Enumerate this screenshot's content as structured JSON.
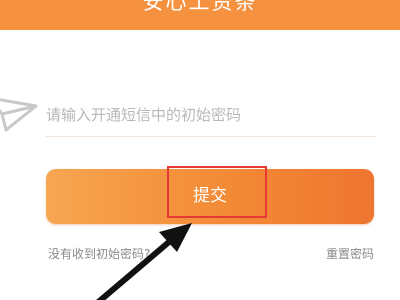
{
  "header": {
    "title": "安心工资条"
  },
  "password_field": {
    "placeholder": "请输入开通短信中的初始密码",
    "value": ""
  },
  "submit": {
    "label": "提交"
  },
  "links": {
    "no_password": "没有收到初始密码?",
    "reset_password": "重置密码"
  },
  "colors": {
    "accent": "#f5913f",
    "highlight": "#e53935"
  },
  "icons": {
    "field_icon": "send-icon",
    "pointer": "arrow-annotation"
  }
}
